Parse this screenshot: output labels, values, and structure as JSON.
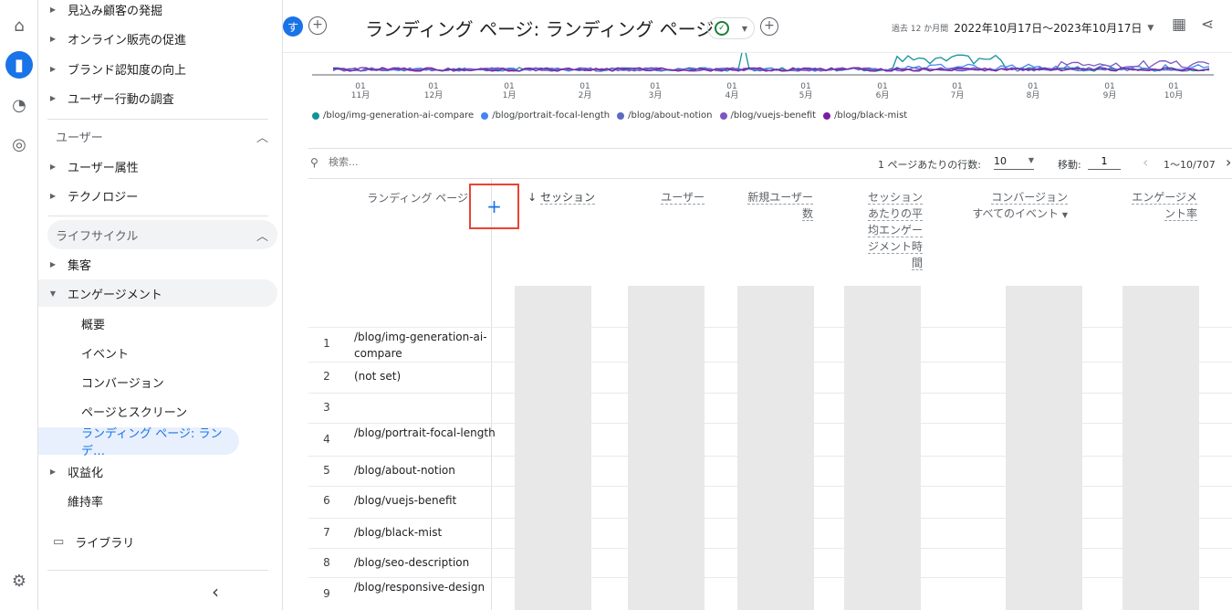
{
  "rail": {
    "icons": [
      "home-icon",
      "reports-icon",
      "explore-icon",
      "advertising-icon",
      "settings-icon"
    ]
  },
  "sidebar": {
    "top_items": [
      {
        "label": "見込み顧客の発掘"
      },
      {
        "label": "オンライン販売の促進"
      },
      {
        "label": "ブランド認知度の向上"
      },
      {
        "label": "ユーザー行動の調査"
      }
    ],
    "user_section": "ユーザー",
    "user_items": [
      {
        "label": "ユーザー属性"
      },
      {
        "label": "テクノロジー"
      }
    ],
    "lifecycle_section": "ライフサイクル",
    "lifecycle_items": [
      {
        "label": "集客"
      },
      {
        "label": "エンゲージメント"
      }
    ],
    "engagement_sub": [
      {
        "label": "概要"
      },
      {
        "label": "イベント"
      },
      {
        "label": "コンバージョン"
      },
      {
        "label": "ページとスクリーン"
      },
      {
        "label": "ランディング ページ: ランデ…"
      }
    ],
    "monetization": "収益化",
    "retention": "維持率",
    "library": "ライブラリ",
    "collapse": "‹"
  },
  "header": {
    "avatar": "す",
    "title": "ランディング ページ: ランディング ページ",
    "date_prefix": "過去 12 か月間",
    "date_range": "2022年10月17日〜2023年10月17日"
  },
  "chart_data": {
    "type": "line",
    "x_ticks": [
      {
        "day": "01",
        "month": "11月"
      },
      {
        "day": "01",
        "month": "12月"
      },
      {
        "day": "01",
        "month": "1月"
      },
      {
        "day": "01",
        "month": "2月"
      },
      {
        "day": "01",
        "month": "3月"
      },
      {
        "day": "01",
        "month": "4月"
      },
      {
        "day": "01",
        "month": "5月"
      },
      {
        "day": "01",
        "month": "6月"
      },
      {
        "day": "01",
        "month": "7月"
      },
      {
        "day": "01",
        "month": "8月"
      },
      {
        "day": "01",
        "month": "9月"
      },
      {
        "day": "01",
        "month": "10月"
      }
    ],
    "series": [
      {
        "name": "/blog/img-generation-ai-compare",
        "color": "#12939a"
      },
      {
        "name": "/blog/portrait-focal-length",
        "color": "#4285f4"
      },
      {
        "name": "/blog/about-notion",
        "color": "#5c6bc0"
      },
      {
        "name": "/blog/vuejs-benefit",
        "color": "#7e57c2"
      },
      {
        "name": "/blog/black-mist",
        "color": "#7b1fa2"
      }
    ]
  },
  "toolbar": {
    "search_placeholder": "検索...",
    "rows_label": "1 ページあたりの行数:",
    "rows_value": "10",
    "goto_label": "移動:",
    "goto_value": "1",
    "pager": "1〜10/707"
  },
  "table": {
    "col_landing": "ランディング ページ",
    "col_sessions": "セッション",
    "col_users": "ユーザー",
    "col_new_users": "新規ユーザー数",
    "col_avg_engagement": "セッションあたりの平均エンゲージメント時間",
    "col_conversions": "コンバージョン",
    "col_conversions_sub": "すべてのイベント",
    "col_engagement_rate": "エンゲージメント率",
    "rows": [
      {
        "num": "1",
        "page": "/blog/img-generation-ai-compare"
      },
      {
        "num": "2",
        "page": "(not set)"
      },
      {
        "num": "3",
        "page": ""
      },
      {
        "num": "4",
        "page": "/blog/portrait-focal-length"
      },
      {
        "num": "5",
        "page": "/blog/about-notion"
      },
      {
        "num": "6",
        "page": "/blog/vuejs-benefit"
      },
      {
        "num": "7",
        "page": "/blog/black-mist"
      },
      {
        "num": "8",
        "page": "/blog/seo-description"
      },
      {
        "num": "9",
        "page": "/blog/responsive-design"
      }
    ]
  }
}
